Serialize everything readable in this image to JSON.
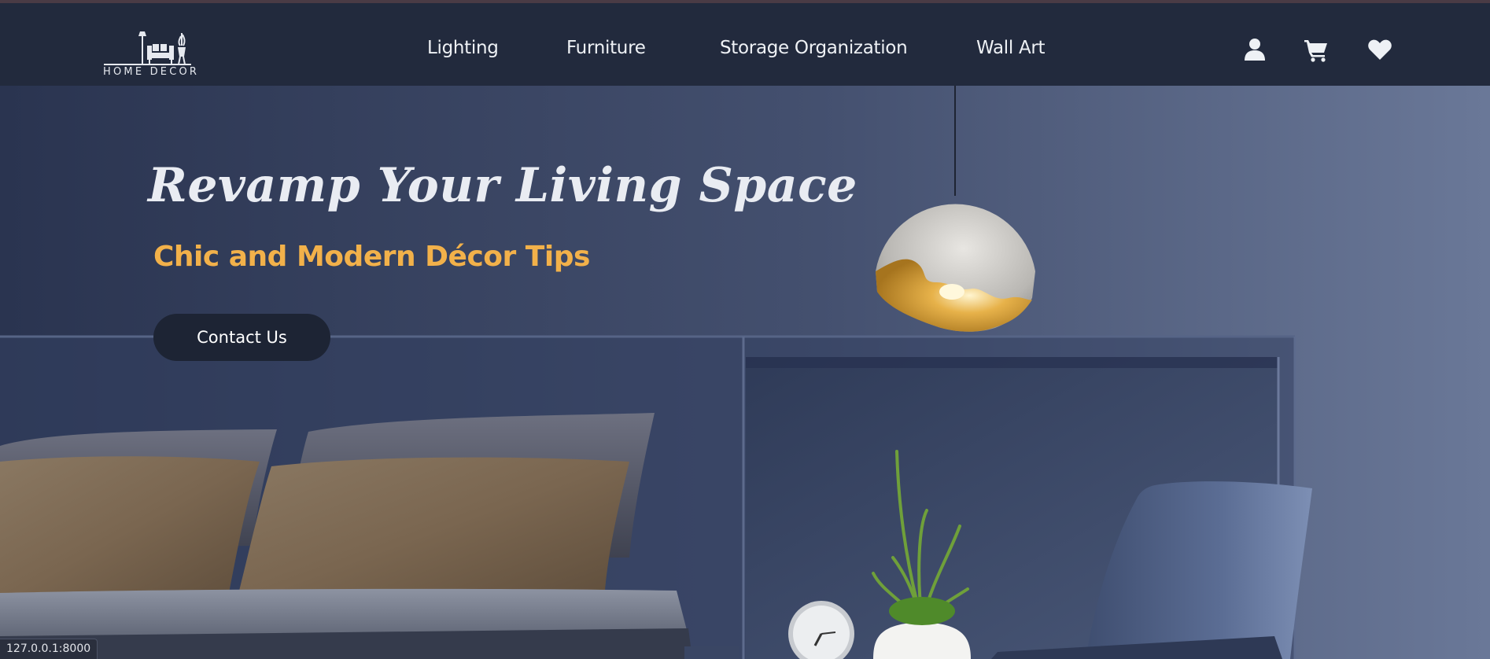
{
  "brand": {
    "logo_text": "HOME DECOR"
  },
  "nav": {
    "links": [
      {
        "label": "Lighting"
      },
      {
        "label": "Furniture"
      },
      {
        "label": "Storage Organization"
      },
      {
        "label": "Wall Art"
      }
    ],
    "icons": [
      "user-icon",
      "cart-icon",
      "heart-icon"
    ]
  },
  "hero": {
    "title": "Revamp Your Living Space",
    "subtitle": "Chic and Modern Décor Tips",
    "cta_label": "Contact Us"
  },
  "status_bar": {
    "url": "127.0.0.1:8000"
  },
  "colors": {
    "navbar_bg": "#222a3d",
    "accent": "#f2b14a",
    "button_bg": "#1d2434",
    "text_light": "#eef1f5"
  }
}
